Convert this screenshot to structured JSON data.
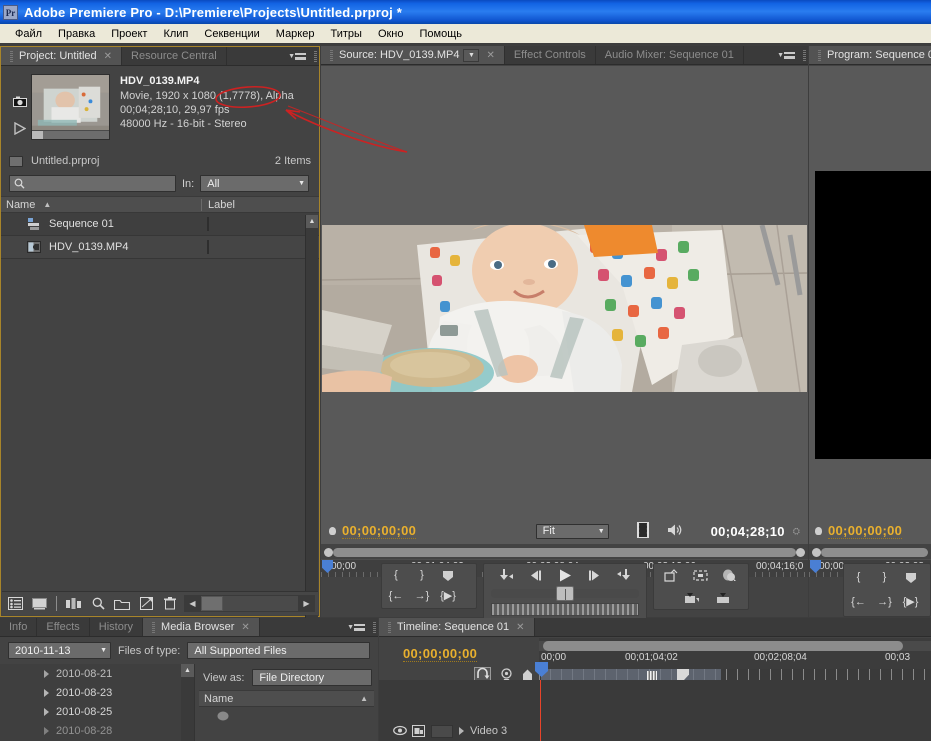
{
  "window": {
    "app_name": "Adobe Premiere Pro",
    "logo_text": "Pr",
    "title": "Adobe Premiere Pro - D:\\Premiere\\Projects\\Untitled.prproj *"
  },
  "menubar": {
    "items": [
      {
        "label": "Файл",
        "accel": "Ф"
      },
      {
        "label": "Правка",
        "accel": "П"
      },
      {
        "label": "Проект",
        "accel": "П"
      },
      {
        "label": "Клип",
        "accel": "К"
      },
      {
        "label": "Секвенции",
        "accel": "С"
      },
      {
        "label": "Маркер",
        "accel": ""
      },
      {
        "label": "Титры",
        "accel": ""
      },
      {
        "label": "Окно",
        "accel": "О"
      },
      {
        "label": "Помощь",
        "accel": ""
      }
    ]
  },
  "project_panel": {
    "tabs": [
      {
        "label": "Project: Untitled",
        "active": true,
        "closable": true
      },
      {
        "label": "Resource Central",
        "active": false,
        "closable": false
      }
    ],
    "preview": {
      "clip_name": "HDV_0139.MP4",
      "line_type": "Movie, 1920 x 1080 (1,7778), Alpha",
      "line_type_prefix": "Movie, 1920 x 1080 ",
      "line_type_ratio": "(1,7778)",
      "line_type_suffix": ", Alpha",
      "line_duration": "00;04;28;10, 29,97 fps",
      "line_audio": "48000 Hz - 16-bit - Stereo"
    },
    "project_file": "Untitled.prproj",
    "item_count": "2 Items",
    "search": {
      "value": "",
      "placeholder": ""
    },
    "filter": {
      "label": "In:",
      "value": "All"
    },
    "columns": [
      {
        "label": "Name"
      },
      {
        "label": "Label"
      }
    ],
    "rows": [
      {
        "name": "Sequence 01",
        "icon": "sequence-icon",
        "label_color": "#9aa6a6"
      },
      {
        "name": "HDV_0139.MP4",
        "icon": "clip-icon",
        "label_color": "#a8c5c0"
      }
    ],
    "footer_icons": [
      "list-view-icon",
      "icon-view-icon",
      "freeform-icon",
      "find-icon",
      "new-bin-icon",
      "new-item-icon",
      "delete-icon"
    ]
  },
  "source_monitor": {
    "tabs": [
      {
        "label": "Source: HDV_0139.MP4",
        "active": true,
        "has_dropdown": true,
        "closable": true
      },
      {
        "label": "Effect Controls",
        "active": false
      },
      {
        "label": "Audio Mixer: Sequence 01",
        "active": false
      }
    ],
    "playhead_timecode": "00;00;00;00",
    "duration_timecode": "00;04;28;10",
    "zoom_level": "Fit",
    "ruler_labels": [
      "00;00",
      "00;01;04;02",
      "00;02;08;04",
      "00;03;12;06",
      "00;04;16;0"
    ],
    "icons": {
      "film_strip": "film-strip-icon",
      "speaker": "speaker-icon",
      "settings": "output-settings-icon"
    },
    "buttons": [
      "mark-in-button",
      "mark-out-button",
      "add-marker-button",
      "go-to-in-button",
      "go-to-out-button",
      "play-in-to-out-button",
      "step-back-to-in-button",
      "step-back-button",
      "play-stop-button",
      "step-forward-button",
      "step-forward-to-out-button",
      "insert-button",
      "overwrite-button",
      "export-frame-button",
      "lift-button",
      "extract-button"
    ]
  },
  "program_monitor": {
    "tabs": [
      {
        "label": "Program: Sequence 0",
        "active": true
      }
    ],
    "playhead_timecode": "00;00;00;00",
    "ruler_labels": [
      "00;00",
      "00;02;08;"
    ]
  },
  "media_browser": {
    "tabs": [
      {
        "label": "Info",
        "active": false
      },
      {
        "label": "Effects",
        "active": false
      },
      {
        "label": "History",
        "active": false
      },
      {
        "label": "Media Browser",
        "active": true,
        "closable": true
      }
    ],
    "directory_combo": "2010-11-13",
    "files_of_type_label": "Files of type:",
    "files_of_type_value": "All Supported Files",
    "view_as_label": "View as:",
    "view_as_value": "File Directory",
    "column_header": "Name",
    "tree_items": [
      "2010-08-21",
      "2010-08-23",
      "2010-08-25",
      "2010-08-28"
    ]
  },
  "timeline": {
    "tabs": [
      {
        "label": "Timeline: Sequence 01",
        "active": true,
        "closable": true
      }
    ],
    "playhead_timecode": "00;00;00;00",
    "ruler_labels": [
      "00;00",
      "00;01;04;02",
      "00;02;08;04",
      "00;03"
    ],
    "track_name": "Video 3",
    "icons": [
      "snap-toggle-icon",
      "marker-icon",
      "keyframe-icon",
      "eye-icon",
      "sync-lock-icon"
    ]
  },
  "annotation": {
    "type": "red-ellipse-with-arrow",
    "target_text": "(1,7778)",
    "color": "#cc2222"
  },
  "colors": {
    "title_bar": "#1263e3",
    "menu_bar": "#ece9d8",
    "panel_bg": "#434343",
    "active_panel_border": "#a8852a",
    "timecode_yellow": "#e9b02e",
    "playhead_red": "#e8442a",
    "cti_blue": "#4a7fd4"
  }
}
